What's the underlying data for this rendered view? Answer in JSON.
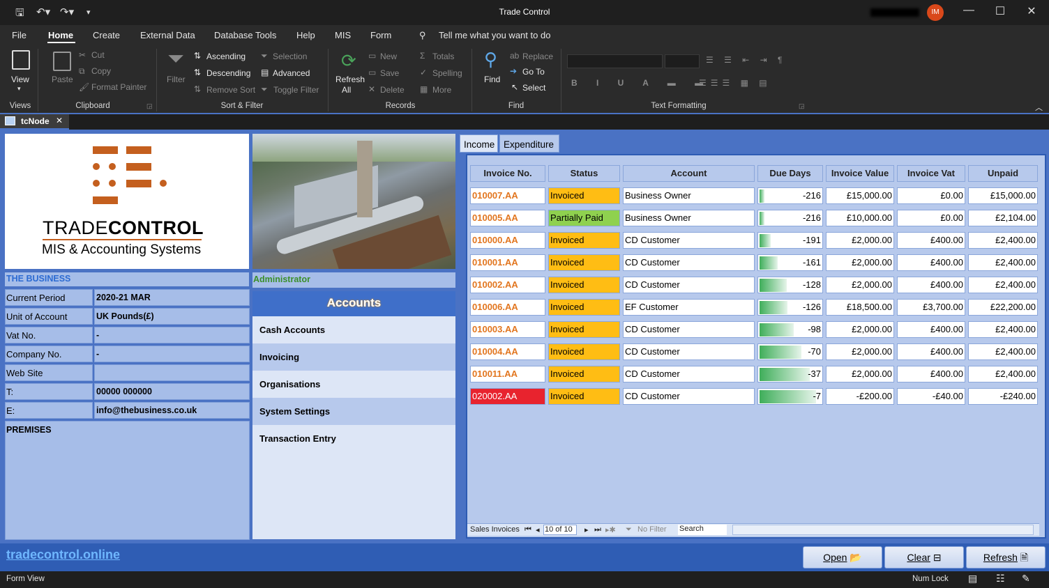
{
  "window": {
    "title": "Trade Control",
    "user_initials": "IM"
  },
  "menu": [
    "File",
    "Home",
    "Create",
    "External Data",
    "Database Tools",
    "Help",
    "MIS",
    "Form"
  ],
  "tell_me": "Tell me what you want to do",
  "ribbon": {
    "views": {
      "view": "View",
      "group": "Views"
    },
    "clipboard": {
      "paste": "Paste",
      "cut": "Cut",
      "copy": "Copy",
      "format_painter": "Format Painter",
      "group": "Clipboard"
    },
    "sort_filter": {
      "filter": "Filter",
      "ascending": "Ascending",
      "descending": "Descending",
      "remove_sort": "Remove Sort",
      "selection": "Selection",
      "advanced": "Advanced",
      "toggle_filter": "Toggle Filter",
      "group": "Sort & Filter"
    },
    "records": {
      "refresh": "Refresh",
      "refresh2": "All",
      "new": "New",
      "save": "Save",
      "delete": "Delete",
      "totals": "Totals",
      "spelling": "Spelling",
      "more": "More",
      "group": "Records"
    },
    "find": {
      "find": "Find",
      "replace": "Replace",
      "goto": "Go To",
      "select": "Select",
      "group": "Find"
    },
    "text_formatting": {
      "group": "Text Formatting"
    }
  },
  "doc_tab": "tcNode",
  "logo": {
    "line1": "TRADE",
    "line1b": "CONTROL",
    "line2": "MIS & Accounting Systems"
  },
  "business": {
    "header": "THE BUSINESS",
    "rows": [
      {
        "label": "Current Period",
        "value": "2020-21 MAR"
      },
      {
        "label": "Unit of Account",
        "value": "UK Pounds(£)"
      },
      {
        "label": "Vat No.",
        "value": "-"
      },
      {
        "label": "Company No.",
        "value": "-"
      },
      {
        "label": "Web Site",
        "value": ""
      },
      {
        "label": "T:",
        "value": "00000 000000"
      },
      {
        "label": "E:",
        "value": "info@thebusiness.co.uk"
      }
    ],
    "premises": "PREMISES"
  },
  "admin": "Administrator",
  "accounts": {
    "title": "Accounts",
    "items": [
      "Cash Accounts",
      "Invoicing",
      "Organisations",
      "System Settings",
      "Transaction Entry"
    ]
  },
  "tabs": [
    "Income",
    "Expenditure"
  ],
  "table": {
    "headers": [
      "Invoice No.",
      "Status",
      "Account",
      "Due Days",
      "Invoice Value",
      "Invoice Vat",
      "Unpaid"
    ],
    "rows": [
      {
        "no": "010007.AA",
        "status": "Invoiced",
        "account": "Business Owner",
        "due": "-216",
        "value": "£15,000.00",
        "vat": "£0.00",
        "unpaid": "£15,000.00",
        "bar": 0.08
      },
      {
        "no": "010005.AA",
        "status": "Partially Paid",
        "account": "Business Owner",
        "due": "-216",
        "value": "£10,000.00",
        "vat": "£0.00",
        "unpaid": "£2,104.00",
        "bar": 0.08
      },
      {
        "no": "010000.AA",
        "status": "Invoiced",
        "account": "CD Customer",
        "due": "-191",
        "value": "£2,000.00",
        "vat": "£400.00",
        "unpaid": "£2,400.00",
        "bar": 0.18
      },
      {
        "no": "010001.AA",
        "status": "Invoiced",
        "account": "CD Customer",
        "due": "-161",
        "value": "£2,000.00",
        "vat": "£400.00",
        "unpaid": "£2,400.00",
        "bar": 0.3
      },
      {
        "no": "010002.AA",
        "status": "Invoiced",
        "account": "CD Customer",
        "due": "-128",
        "value": "£2,000.00",
        "vat": "£400.00",
        "unpaid": "£2,400.00",
        "bar": 0.44
      },
      {
        "no": "010006.AA",
        "status": "Invoiced",
        "account": "EF Customer",
        "due": "-126",
        "value": "£18,500.00",
        "vat": "£3,700.00",
        "unpaid": "£22,200.00",
        "bar": 0.45
      },
      {
        "no": "010003.AA",
        "status": "Invoiced",
        "account": "CD Customer",
        "due": "-98",
        "value": "£2,000.00",
        "vat": "£400.00",
        "unpaid": "£2,400.00",
        "bar": 0.56
      },
      {
        "no": "010004.AA",
        "status": "Invoiced",
        "account": "CD Customer",
        "due": "-70",
        "value": "£2,000.00",
        "vat": "£400.00",
        "unpaid": "£2,400.00",
        "bar": 0.68
      },
      {
        "no": "010011.AA",
        "status": "Invoiced",
        "account": "CD Customer",
        "due": "-37",
        "value": "£2,000.00",
        "vat": "£400.00",
        "unpaid": "£2,400.00",
        "bar": 0.82
      },
      {
        "no": "020002.AA",
        "status": "Invoiced",
        "account": "CD Customer",
        "due": "-7",
        "value": "-£200.00",
        "vat": "-£40.00",
        "unpaid": "-£240.00",
        "bar": 0.92
      }
    ]
  },
  "navbar": {
    "label": "Sales Invoices",
    "record": "10 of 10",
    "filter": "No Filter",
    "search": "Search"
  },
  "footer": {
    "link": "tradecontrol.online",
    "open": "Open",
    "clear": "Clear",
    "refresh": "Refresh"
  },
  "status": {
    "left": "Form View",
    "numlock": "Num Lock"
  },
  "colors": {
    "invoiced": "#ffbd14",
    "partially_paid": "#8fd14f",
    "overdue": "#e8232e",
    "accent": "#4a72c4"
  }
}
